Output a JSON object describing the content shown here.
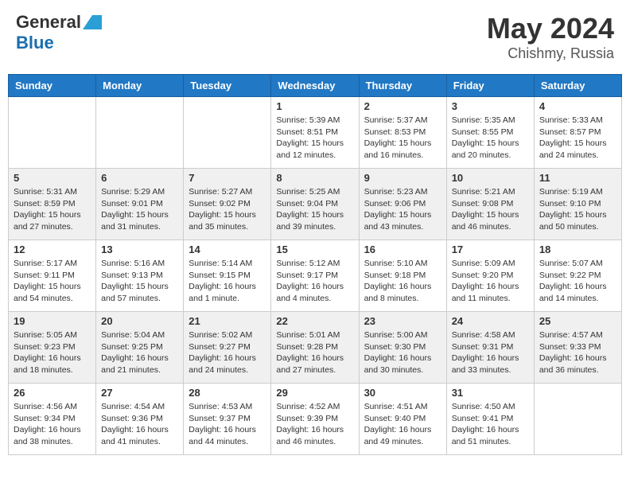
{
  "header": {
    "logo_general": "General",
    "logo_blue": "Blue",
    "title": "May 2024",
    "location": "Chishmy, Russia"
  },
  "days_of_week": [
    "Sunday",
    "Monday",
    "Tuesday",
    "Wednesday",
    "Thursday",
    "Friday",
    "Saturday"
  ],
  "weeks": [
    {
      "shaded": false,
      "days": [
        {
          "num": "",
          "info": ""
        },
        {
          "num": "",
          "info": ""
        },
        {
          "num": "",
          "info": ""
        },
        {
          "num": "1",
          "info": "Sunrise: 5:39 AM\nSunset: 8:51 PM\nDaylight: 15 hours\nand 12 minutes."
        },
        {
          "num": "2",
          "info": "Sunrise: 5:37 AM\nSunset: 8:53 PM\nDaylight: 15 hours\nand 16 minutes."
        },
        {
          "num": "3",
          "info": "Sunrise: 5:35 AM\nSunset: 8:55 PM\nDaylight: 15 hours\nand 20 minutes."
        },
        {
          "num": "4",
          "info": "Sunrise: 5:33 AM\nSunset: 8:57 PM\nDaylight: 15 hours\nand 24 minutes."
        }
      ]
    },
    {
      "shaded": true,
      "days": [
        {
          "num": "5",
          "info": "Sunrise: 5:31 AM\nSunset: 8:59 PM\nDaylight: 15 hours\nand 27 minutes."
        },
        {
          "num": "6",
          "info": "Sunrise: 5:29 AM\nSunset: 9:01 PM\nDaylight: 15 hours\nand 31 minutes."
        },
        {
          "num": "7",
          "info": "Sunrise: 5:27 AM\nSunset: 9:02 PM\nDaylight: 15 hours\nand 35 minutes."
        },
        {
          "num": "8",
          "info": "Sunrise: 5:25 AM\nSunset: 9:04 PM\nDaylight: 15 hours\nand 39 minutes."
        },
        {
          "num": "9",
          "info": "Sunrise: 5:23 AM\nSunset: 9:06 PM\nDaylight: 15 hours\nand 43 minutes."
        },
        {
          "num": "10",
          "info": "Sunrise: 5:21 AM\nSunset: 9:08 PM\nDaylight: 15 hours\nand 46 minutes."
        },
        {
          "num": "11",
          "info": "Sunrise: 5:19 AM\nSunset: 9:10 PM\nDaylight: 15 hours\nand 50 minutes."
        }
      ]
    },
    {
      "shaded": false,
      "days": [
        {
          "num": "12",
          "info": "Sunrise: 5:17 AM\nSunset: 9:11 PM\nDaylight: 15 hours\nand 54 minutes."
        },
        {
          "num": "13",
          "info": "Sunrise: 5:16 AM\nSunset: 9:13 PM\nDaylight: 15 hours\nand 57 minutes."
        },
        {
          "num": "14",
          "info": "Sunrise: 5:14 AM\nSunset: 9:15 PM\nDaylight: 16 hours\nand 1 minute."
        },
        {
          "num": "15",
          "info": "Sunrise: 5:12 AM\nSunset: 9:17 PM\nDaylight: 16 hours\nand 4 minutes."
        },
        {
          "num": "16",
          "info": "Sunrise: 5:10 AM\nSunset: 9:18 PM\nDaylight: 16 hours\nand 8 minutes."
        },
        {
          "num": "17",
          "info": "Sunrise: 5:09 AM\nSunset: 9:20 PM\nDaylight: 16 hours\nand 11 minutes."
        },
        {
          "num": "18",
          "info": "Sunrise: 5:07 AM\nSunset: 9:22 PM\nDaylight: 16 hours\nand 14 minutes."
        }
      ]
    },
    {
      "shaded": true,
      "days": [
        {
          "num": "19",
          "info": "Sunrise: 5:05 AM\nSunset: 9:23 PM\nDaylight: 16 hours\nand 18 minutes."
        },
        {
          "num": "20",
          "info": "Sunrise: 5:04 AM\nSunset: 9:25 PM\nDaylight: 16 hours\nand 21 minutes."
        },
        {
          "num": "21",
          "info": "Sunrise: 5:02 AM\nSunset: 9:27 PM\nDaylight: 16 hours\nand 24 minutes."
        },
        {
          "num": "22",
          "info": "Sunrise: 5:01 AM\nSunset: 9:28 PM\nDaylight: 16 hours\nand 27 minutes."
        },
        {
          "num": "23",
          "info": "Sunrise: 5:00 AM\nSunset: 9:30 PM\nDaylight: 16 hours\nand 30 minutes."
        },
        {
          "num": "24",
          "info": "Sunrise: 4:58 AM\nSunset: 9:31 PM\nDaylight: 16 hours\nand 33 minutes."
        },
        {
          "num": "25",
          "info": "Sunrise: 4:57 AM\nSunset: 9:33 PM\nDaylight: 16 hours\nand 36 minutes."
        }
      ]
    },
    {
      "shaded": false,
      "days": [
        {
          "num": "26",
          "info": "Sunrise: 4:56 AM\nSunset: 9:34 PM\nDaylight: 16 hours\nand 38 minutes."
        },
        {
          "num": "27",
          "info": "Sunrise: 4:54 AM\nSunset: 9:36 PM\nDaylight: 16 hours\nand 41 minutes."
        },
        {
          "num": "28",
          "info": "Sunrise: 4:53 AM\nSunset: 9:37 PM\nDaylight: 16 hours\nand 44 minutes."
        },
        {
          "num": "29",
          "info": "Sunrise: 4:52 AM\nSunset: 9:39 PM\nDaylight: 16 hours\nand 46 minutes."
        },
        {
          "num": "30",
          "info": "Sunrise: 4:51 AM\nSunset: 9:40 PM\nDaylight: 16 hours\nand 49 minutes."
        },
        {
          "num": "31",
          "info": "Sunrise: 4:50 AM\nSunset: 9:41 PM\nDaylight: 16 hours\nand 51 minutes."
        },
        {
          "num": "",
          "info": ""
        }
      ]
    }
  ]
}
